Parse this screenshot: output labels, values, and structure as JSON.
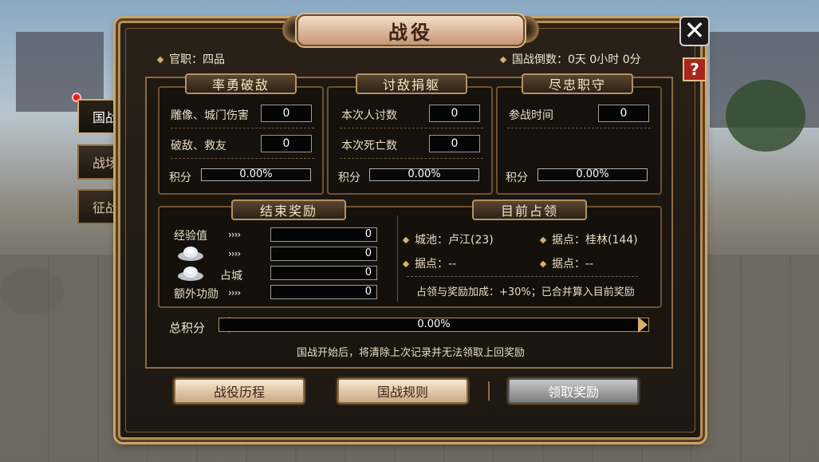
{
  "window": {
    "title": "战役"
  },
  "header": {
    "rank": "官职：四品",
    "countdown": "国战倒数：0天 0小时 0分"
  },
  "controls": {
    "close_glyph": "✕",
    "help_glyph": "?"
  },
  "side_tabs": [
    {
      "label": "国战",
      "active": true
    },
    {
      "label": "战场",
      "active": false
    },
    {
      "label": "征战",
      "active": false
    }
  ],
  "panels": {
    "valor": {
      "title": "率勇破敌",
      "rows": [
        {
          "label": "雕像、城门伤害",
          "value": "0"
        },
        {
          "label": "破敌、救友",
          "value": "0"
        }
      ],
      "score_label": "积分",
      "score": "0.00%"
    },
    "kill": {
      "title": "讨敌捐躯",
      "rows": [
        {
          "label": "本次人讨数",
          "value": "0"
        },
        {
          "label": "本次死亡数",
          "value": "0"
        }
      ],
      "score_label": "积分",
      "score": "0.00%"
    },
    "loyal": {
      "title": "尽忠职守",
      "rows": [
        {
          "label": "参战时间",
          "value": "0"
        }
      ],
      "score_label": "积分",
      "score": "0.00%"
    }
  },
  "rewards": {
    "title": "结束奖励",
    "rows": [
      {
        "label": "经验值",
        "icon": "",
        "value": "0"
      },
      {
        "label": "",
        "icon": "silver-ingot-icon",
        "value": "0"
      },
      {
        "label": "占城",
        "icon": "silver-ingot-icon",
        "value": "0"
      },
      {
        "label": "额外功勋",
        "icon": "",
        "value": "0"
      }
    ],
    "arrow_glyph": "››››"
  },
  "occupation": {
    "title": "目前占领",
    "items": [
      "城池：卢江(23)",
      "据点：桂林(144)",
      "据点：--",
      "据点：--"
    ],
    "note": "占领与奖励加成：+30%；已合并算入目前奖励"
  },
  "total": {
    "label": "总积分",
    "value": "0.00%"
  },
  "notice": "国战开始后，将清除上次记录并无法领取上回奖励",
  "buttons": {
    "history": "战役历程",
    "rules": "国战规则",
    "claim": "领取奖励"
  },
  "colors": {
    "accent": "#b58f57",
    "panel_bg": "#1d1812",
    "title_plate": "#d9b294",
    "help_red": "#a8261c"
  }
}
